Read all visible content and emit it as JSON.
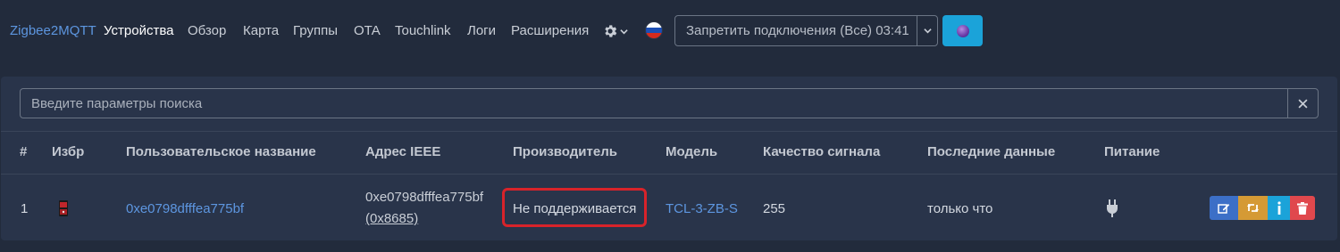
{
  "navbar": {
    "brand": "Zigbee2MQTT",
    "items": [
      {
        "label": "Устройства",
        "active": true
      },
      {
        "label": "Обзор"
      },
      {
        "label": "Карта"
      },
      {
        "label": "Группы"
      },
      {
        "label": "OTA"
      },
      {
        "label": "Touchlink"
      },
      {
        "label": "Логи"
      },
      {
        "label": "Расширения"
      }
    ],
    "settings_icon": "gear-icon",
    "language_flag": "russia-flag-icon",
    "permit_join_label": "Запретить подключения (Все) 03:41",
    "theme_icon": "theme-orb-icon"
  },
  "search": {
    "placeholder": "Введите параметры поиска",
    "clear_icon": "close-icon"
  },
  "table": {
    "headers": [
      "#",
      "Избр",
      "Пользовательское название",
      "Адрес IEEE",
      "Производитель",
      "Модель",
      "Качество сигнала",
      "Последние данные",
      "Питание"
    ],
    "rows": [
      {
        "index": "1",
        "friendly_name": "0xe0798dfffea775bf",
        "ieee": "0xe0798dfffea775bf",
        "nwk": "(0x8685)",
        "manufacturer": "Не поддерживается",
        "model": "TCL-3-ZB-S",
        "lqi": "255",
        "last_seen": "только что",
        "power_icon": "plug-icon"
      }
    ]
  },
  "colors": {
    "background": "#222b3c",
    "card": "#29344a",
    "link": "#5d96e0",
    "highlight": "#d8232a",
    "edit": "#3c6fc7",
    "rename": "#d59a35",
    "info": "#1ba3d9",
    "delete": "#e0484d"
  }
}
